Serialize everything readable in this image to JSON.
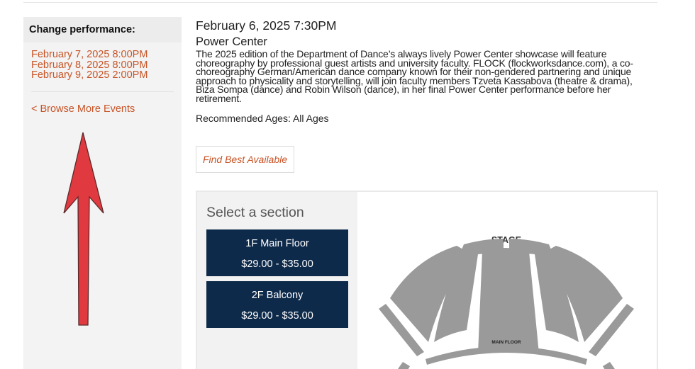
{
  "sidebar": {
    "heading": "Change performance:",
    "performances": [
      "February 7, 2025 8:00PM",
      "February 8, 2025 8:00PM",
      "February 9, 2025 2:00PM"
    ],
    "browse_link": "< Browse More Events"
  },
  "event": {
    "date_time": "February 6, 2025 7:30PM",
    "venue": "Power Center",
    "description_lines": [
      "The 2025 edition of the Department of Dance’s always lively Power Center showcase will feature",
      "choreography by professional guest artists and university faculty. FLOCK (flockworksdance.com), a co-",
      "choreography German/American dance company known for their non-gendered partnering and unique",
      "approach to physicality and storytelling, will join faculty members Tzveta Kassabova (theatre & drama),",
      "Biza Sompa (dance) and Robin Wilson (dance), in her final Power Center performance before her",
      "retirement."
    ],
    "recommended_ages": "Recommended Ages: All Ages"
  },
  "actions": {
    "find_best": "Find Best Available"
  },
  "seating": {
    "select_title": "Select a section",
    "sections": [
      {
        "name": "1F Main Floor",
        "price": "$29.00 - $35.00"
      },
      {
        "name": "2F Balcony",
        "price": "$29.00 - $35.00"
      }
    ],
    "map_labels": {
      "stage": "STAGE",
      "main_floor": "MAIN FLOOR"
    }
  },
  "colors": {
    "link": "#c75426",
    "section_button": "#0e2a4b",
    "annotation_arrow": "#e03a40",
    "seat_block": "#9a9a9a"
  },
  "icons": {
    "annotation": "up-arrow-annotation"
  }
}
